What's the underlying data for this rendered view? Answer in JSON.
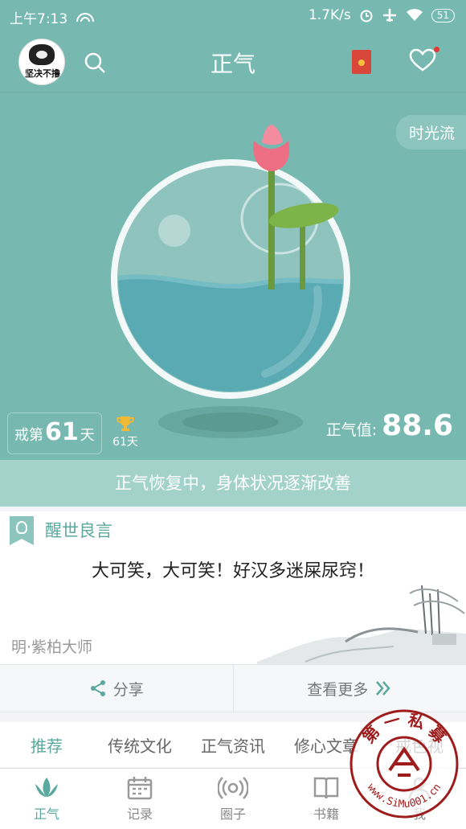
{
  "status": {
    "time": "上午7:13",
    "speed": "1.7K/s",
    "battery": "51"
  },
  "header": {
    "title": "正气",
    "avatar_caption": "坚决不撸"
  },
  "hero": {
    "time_flow": "时光流",
    "days_prefix": "戒第",
    "days_value": "61",
    "days_suffix": "天",
    "trophy_days": "61天",
    "zq_label": "正气值:",
    "zq_value": "88.6"
  },
  "banner": "正气恢复中，身体状况逐渐改善",
  "quote_card": {
    "heading": "醒世良言",
    "quote": "大可笑，大可笑！好汉多迷屎尿窍！",
    "author": "明·紫柏大师"
  },
  "actions": {
    "share": "分享",
    "more": "查看更多"
  },
  "categories": [
    {
      "label": "推荐"
    },
    {
      "label": "传统文化"
    },
    {
      "label": "正气资讯"
    },
    {
      "label": "修心文章"
    },
    {
      "label": "戒色视"
    }
  ],
  "tabs": [
    {
      "label": "正气"
    },
    {
      "label": "记录"
    },
    {
      "label": "圈子"
    },
    {
      "label": "书籍"
    },
    {
      "label": "我"
    }
  ],
  "watermark": {
    "text": "第 一 私 募",
    "url": "www.SiMu001.cn"
  },
  "colors": {
    "primary": "#77b9b1",
    "accent": "#5aa89e",
    "banner": "#a3d2cb"
  },
  "icons": [
    "signal-icon",
    "alarm-icon",
    "airplane-icon",
    "wifi-icon",
    "battery-icon",
    "search-icon",
    "red-packet-icon",
    "heart-icon",
    "trophy-icon",
    "bulb-icon",
    "share-icon",
    "double-chevron-icon",
    "lotus-icon",
    "calendar-icon",
    "broadcast-icon",
    "book-icon",
    "person-icon"
  ]
}
